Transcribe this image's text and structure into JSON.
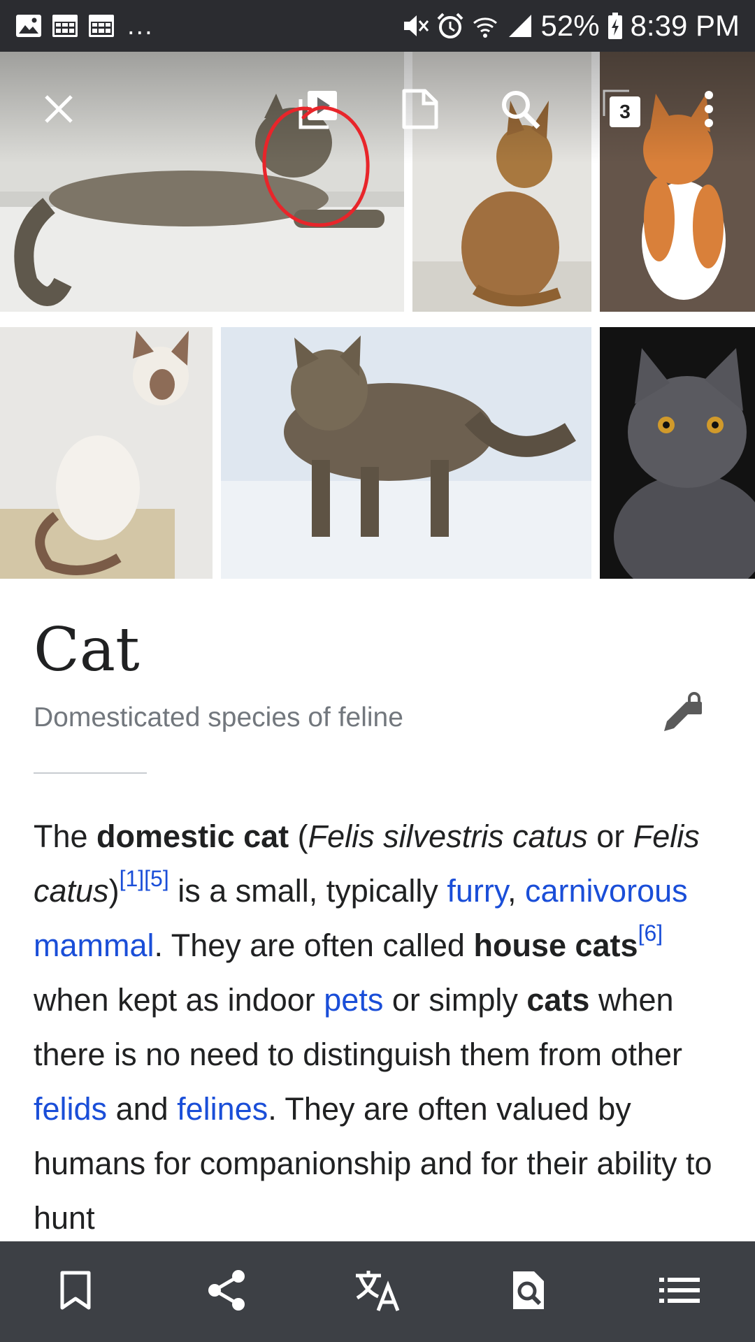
{
  "status_bar": {
    "icons_left": [
      "gallery-notification-icon",
      "calendar-notification-icon",
      "calendar-notification-icon"
    ],
    "more": "...",
    "icons_right": [
      "mute-icon",
      "alarm-icon",
      "wifi-icon",
      "signal-icon"
    ],
    "battery": "52%",
    "time": "8:39 PM"
  },
  "toolbar": {
    "close_icon": "close-icon",
    "gallery_icon": "play-gallery-icon",
    "reading_list_icon": "page-icon",
    "search_icon": "search-icon",
    "tabs_count": "3",
    "overflow_icon": "overflow-menu-icon",
    "annotation_color": "#e8252a"
  },
  "article": {
    "title": "Cat",
    "description": "Domesticated species of feline",
    "body": {
      "t1": "The ",
      "b1": "domestic cat",
      "t2": " (",
      "i1": "Felis silvestris catus",
      "t3": " or ",
      "i2": "Felis catus",
      "t4": ")",
      "ref1": "[1]",
      "ref5": "[5]",
      "t5": " is a small, typically ",
      "link_furry": "furry",
      "t6": ", ",
      "link_carnivorous": "carnivorous mammal",
      "t7": ". They are often called ",
      "b2": "house cats",
      "ref6": "[6]",
      "t8": " when kept as indoor ",
      "link_pets": "pets",
      "t9": " or simply ",
      "b3": "cats",
      "t10": " when there is no need to distinguish them from other ",
      "link_felids": "felids",
      "t11": " and ",
      "link_felines": "felines",
      "t12": ". They are often valued by humans for companionship and for their ability to hunt"
    }
  },
  "bottom_nav": [
    "bookmark-icon",
    "share-icon",
    "translate-icon",
    "find-in-page-icon",
    "contents-icon"
  ],
  "colors": {
    "status_bar": "#2b2c30",
    "bottom_bar": "#3d4045",
    "link": "#1a4ed8"
  }
}
